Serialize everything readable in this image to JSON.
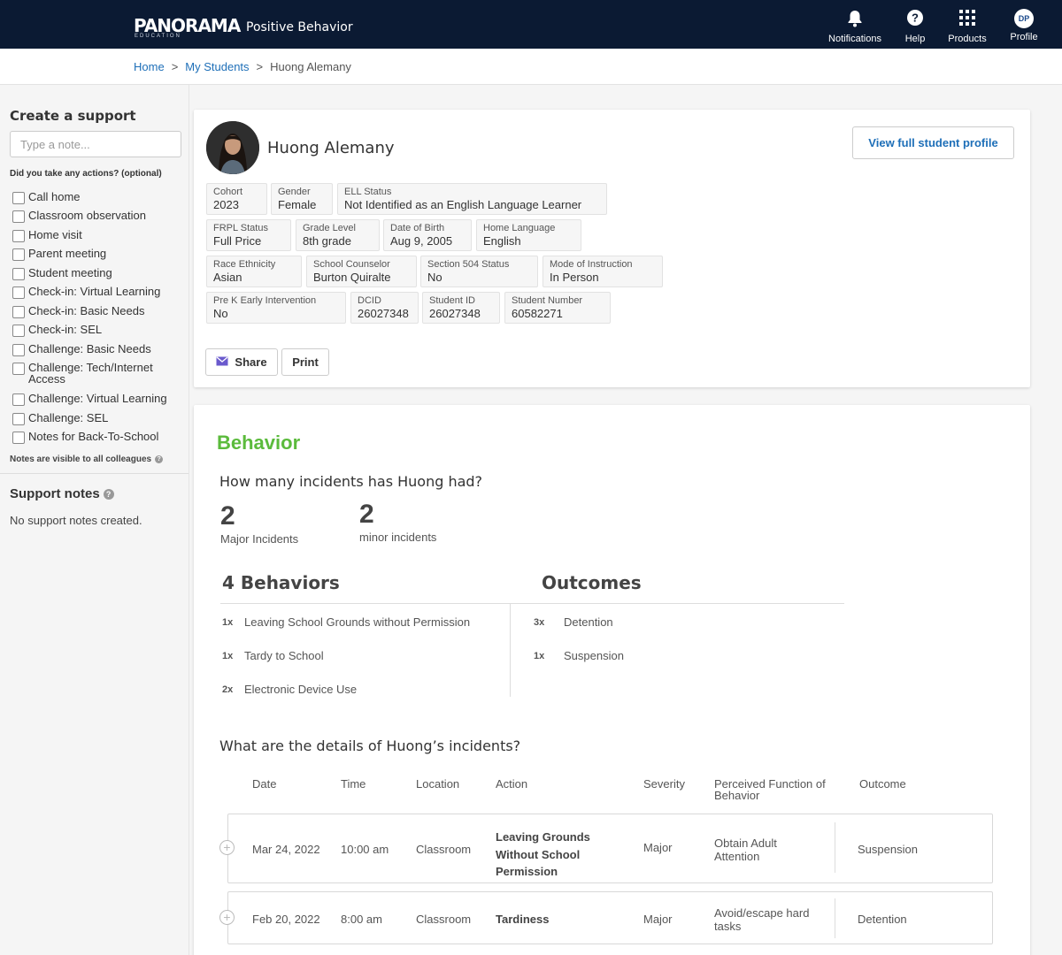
{
  "header": {
    "logo": "PANORAMA",
    "logo_sub": "EDUCATION",
    "app_title": "Positive Behavior",
    "nav": {
      "notifications": "Notifications",
      "help": "Help",
      "products": "Products",
      "profile": "Profile",
      "profile_initials": "DP"
    }
  },
  "breadcrumb": {
    "home": "Home",
    "sep": ">",
    "my_students": "My Students",
    "current": "Huong Alemany"
  },
  "sidebar": {
    "create_title": "Create a support",
    "note_placeholder": "Type a note...",
    "actions_label": "Did you take any actions? (optional)",
    "actions": [
      "Call home",
      "Classroom observation",
      "Home visit",
      "Parent meeting",
      "Student meeting",
      "Check-in: Virtual Learning",
      "Check-in: Basic Needs",
      "Check-in: SEL",
      "Challenge: Basic Needs",
      "Challenge: Tech/Internet Access",
      "Challenge: Virtual Learning",
      "Challenge: SEL",
      "Notes for Back-To-School"
    ],
    "notes_visible": "Notes are visible to all colleagues",
    "support_notes_title": "Support notes",
    "support_notes_empty": "No support notes created."
  },
  "student": {
    "name": "Huong Alemany",
    "view_profile": "View full student profile",
    "fields": {
      "cohort": {
        "label": "Cohort",
        "value": "2023"
      },
      "gender": {
        "label": "Gender",
        "value": "Female"
      },
      "ell": {
        "label": "ELL Status",
        "value": "Not Identified as an English Language Learner"
      },
      "frpl": {
        "label": "FRPL Status",
        "value": "Full Price"
      },
      "grade": {
        "label": "Grade Level",
        "value": "8th grade"
      },
      "dob": {
        "label": "Date of Birth",
        "value": "Aug 9, 2005"
      },
      "language": {
        "label": "Home Language",
        "value": "English"
      },
      "race": {
        "label": "Race Ethnicity",
        "value": "Asian"
      },
      "counselor": {
        "label": "School Counselor",
        "value": "Burton Quiralte"
      },
      "s504": {
        "label": "Section 504 Status",
        "value": "No"
      },
      "instruction": {
        "label": "Mode of Instruction",
        "value": "In Person"
      },
      "prek": {
        "label": "Pre K Early Intervention",
        "value": "No"
      },
      "dcid": {
        "label": "DCID",
        "value": "26027348"
      },
      "student_id": {
        "label": "Student ID",
        "value": "26027348"
      },
      "student_number": {
        "label": "Student Number",
        "value": "60582271"
      }
    },
    "share": "Share",
    "print": "Print"
  },
  "behavior": {
    "title": "Behavior",
    "question": "How many incidents has Huong had?",
    "major_count": "2",
    "major_label": "Major Incidents",
    "minor_count": "2",
    "minor_label": "minor incidents",
    "behaviors_title": "4 Behaviors",
    "outcomes_title": "Outcomes",
    "behaviors": [
      {
        "count": "1x",
        "name": "Leaving School Grounds without Permission"
      },
      {
        "count": "1x",
        "name": "Tardy to School"
      },
      {
        "count": "2x",
        "name": "Electronic Device Use"
      }
    ],
    "outcomes": [
      {
        "count": "3x",
        "name": "Detention"
      },
      {
        "count": "1x",
        "name": "Suspension"
      }
    ],
    "details_question": "What are the details of Huong’s incidents?",
    "table_headers": {
      "date": "Date",
      "time": "Time",
      "location": "Location",
      "action": "Action",
      "severity": "Severity",
      "function": "Perceived Function of Behavior",
      "outcome": "Outcome"
    },
    "incidents": [
      {
        "date": "Mar 24, 2022",
        "time": "10:00 am",
        "location": "Classroom",
        "action": "Leaving Grounds Without School Permission",
        "severity": "Major",
        "function": "Obtain Adult Attention",
        "outcome": "Suspension"
      },
      {
        "date": "Feb 20, 2022",
        "time": "8:00 am",
        "location": "Classroom",
        "action": "Tardiness",
        "severity": "Major",
        "function": "Avoid/escape hard tasks",
        "outcome": "Detention"
      }
    ],
    "expand_symbol": "+"
  },
  "colors": {
    "topbar": "#0b1a33",
    "link": "#1e6fb8",
    "behavior_green": "#5bbb3c",
    "share_icon": "#6a5acd"
  }
}
